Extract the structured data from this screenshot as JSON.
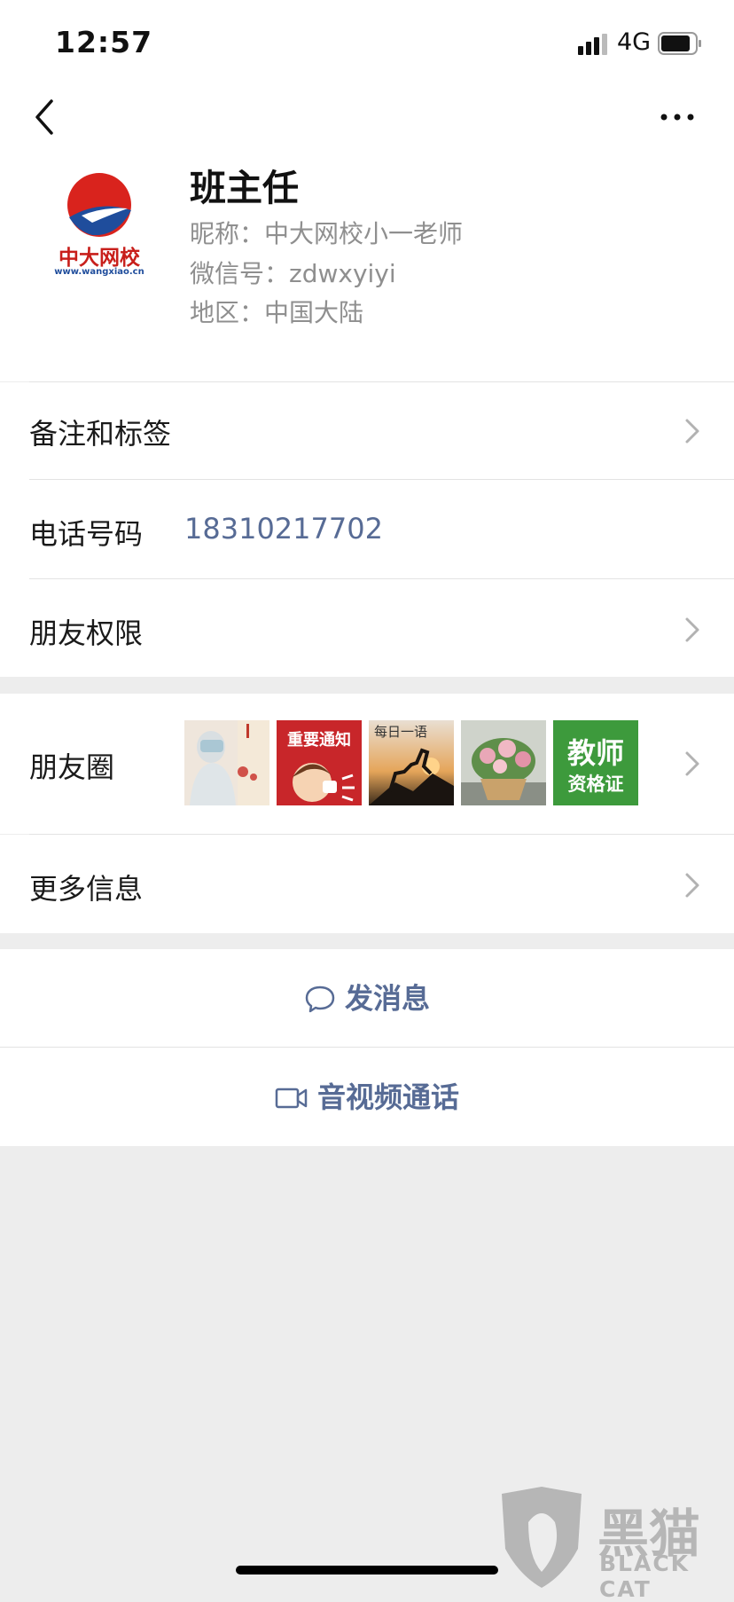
{
  "status_bar": {
    "time": "12:57",
    "network": "4G"
  },
  "profile": {
    "display_name": "班主任",
    "nickname": "昵称：中大网校小一老师",
    "wechat_id": "微信号：zdwxyiyi",
    "region": "地区：中国大陆",
    "avatar": {
      "brand_text": "中大网校",
      "url_text": "www.wangxiao.cn"
    }
  },
  "rows": {
    "remarks_tags": "备注和标签",
    "phone_label": "电话号码",
    "phone_value": "18310217702",
    "friend_permissions": "朋友权限",
    "moments": "朋友圈",
    "more_info": "更多信息"
  },
  "moments_thumbs": {
    "t2_text": "重要通知",
    "t3_text": "每日一语",
    "t5_line1": "教师",
    "t5_line2": "资格证"
  },
  "actions": {
    "send_message": "发消息",
    "av_call": "音视频通话"
  },
  "watermark": {
    "cn": "黑猫",
    "en": "BLACK CAT"
  },
  "colors": {
    "link_blue": "#576b95",
    "bg_gray": "#ededed",
    "cert_green": "#3d9a3c",
    "notice_red": "#c8262a"
  }
}
